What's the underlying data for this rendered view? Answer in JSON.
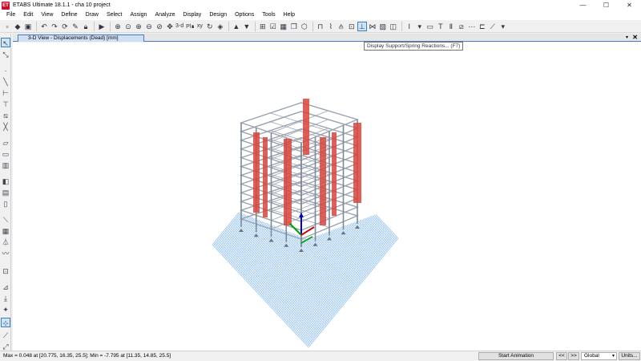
{
  "window": {
    "app_icon_text": "ET",
    "title": "ETABS Ultimate 18.1.1 - cha 10 project",
    "minimize": "—",
    "maximize": "☐",
    "close": "✕"
  },
  "menu": [
    "File",
    "Edit",
    "View",
    "Define",
    "Draw",
    "Select",
    "Assign",
    "Analyze",
    "Display",
    "Design",
    "Options",
    "Tools",
    "Help"
  ],
  "toolbar": {
    "text_3d": "3-d",
    "text_pln": "Pl∎",
    "text_xy": "xy",
    "tooltip": "Display Support/Spring Reactions... (F7)"
  },
  "document_tab": {
    "label": "3-D View  - Displacements (Dead)  [mm]",
    "close": "✕",
    "dropdown": "▾"
  },
  "statusbar": {
    "text": "Max = 0.048 at [20.775, 16.35, 25.5];  Min = -7.795 at [11.35, 14.85, 25.5]",
    "start_animation": "Start Animation",
    "prev": "<<",
    "next": ">>",
    "coord_system": "Global",
    "units": "Units..."
  },
  "colors": {
    "wall_red": "#d9443c",
    "frame_gray": "#9aa4b0",
    "grid_blue": "#9ec8ee",
    "axis_x": "#d00000",
    "axis_y": "#00a000",
    "axis_z": "#0000d0"
  }
}
